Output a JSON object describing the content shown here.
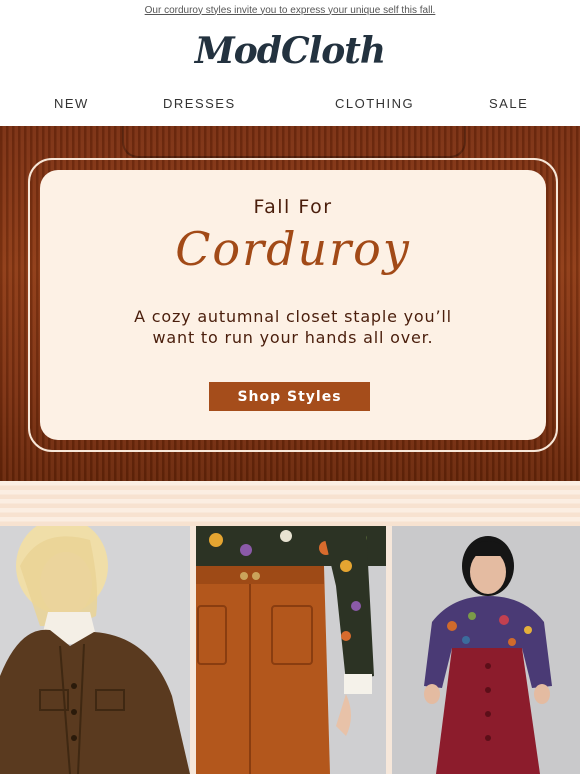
{
  "preheader": {
    "text": "Our corduroy styles invite you to express your unique self this fall."
  },
  "brand": {
    "logo_text": "ModCloth"
  },
  "nav": {
    "items": [
      "NEW",
      "DRESSES",
      "CLOTHING",
      "SALE"
    ]
  },
  "hero": {
    "kicker": "Fall For",
    "title": "Corduroy",
    "body_line1": "A cozy autumnal closet staple you’ll",
    "body_line2": "want to run your hands all over.",
    "cta_label": "Shop Styles"
  },
  "colors": {
    "brand_navy": "#23323f",
    "rust": "#a54d1b",
    "cream": "#fdf1e5",
    "corduroy": "#7a2e10"
  }
}
